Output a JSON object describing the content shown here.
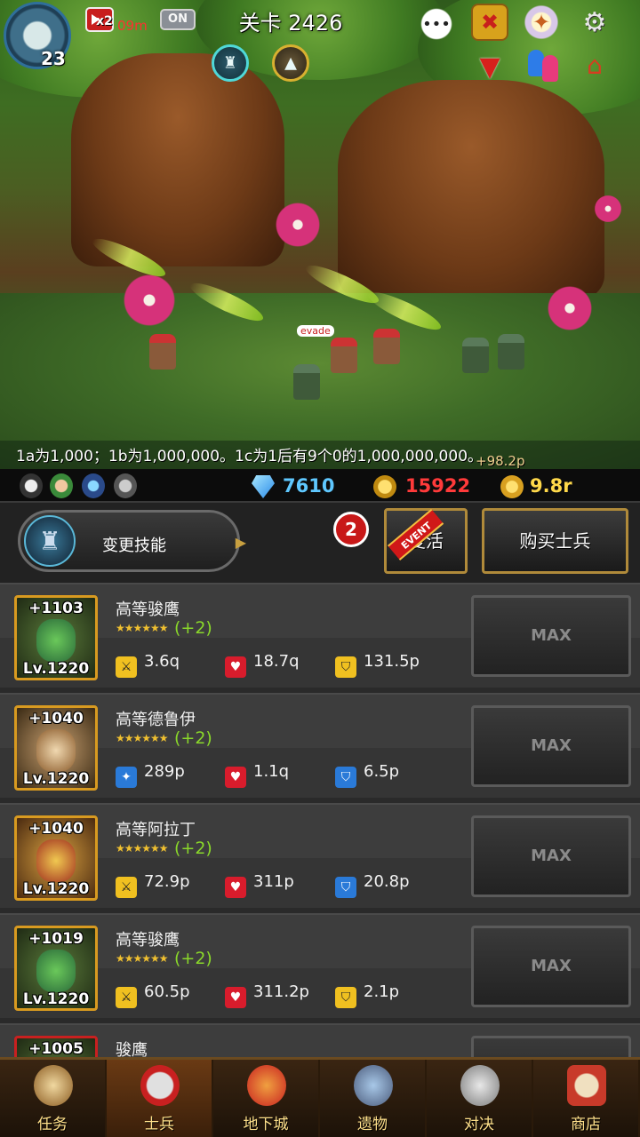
{
  "hud": {
    "hero_level": "23",
    "speed_label": "x2",
    "timer_label": "09m",
    "auto_toggle": "ON",
    "stage_title": "关卡 2426"
  },
  "scene": {
    "evade_tag": "evade",
    "notice": "1a为1,000；1b为1,000,000。1c为1后有9个0的1,000,000,000。",
    "gold_gain": "+98.2p"
  },
  "resources": {
    "gems": "7610",
    "medals": "15922",
    "gold": "9.8r"
  },
  "controls": {
    "change_skill": "变更技能",
    "notify_count": "2",
    "event_ribbon": "EVENT",
    "revive": "复活",
    "buy_soldier": "购买士兵"
  },
  "soldiers": [
    {
      "bonus": "+1103",
      "level": "Lv.1220",
      "name": "高等骏鹰",
      "stars": "★★★★★★",
      "upgrade": "(+2)",
      "stat1": "3.6q",
      "stat2": "18.7q",
      "stat3": "131.5p",
      "button": "MAX"
    },
    {
      "bonus": "+1040",
      "level": "Lv.1220",
      "name": "高等德鲁伊",
      "stars": "★★★★★★",
      "upgrade": "(+2)",
      "stat1": "289p",
      "stat2": "1.1q",
      "stat3": "6.5p",
      "button": "MAX"
    },
    {
      "bonus": "+1040",
      "level": "Lv.1220",
      "name": "高等阿拉丁",
      "stars": "★★★★★★",
      "upgrade": "(+2)",
      "stat1": "72.9p",
      "stat2": "311p",
      "stat3": "20.8p",
      "button": "MAX"
    },
    {
      "bonus": "+1019",
      "level": "Lv.1220",
      "name": "高等骏鹰",
      "stars": "★★★★★★",
      "upgrade": "(+2)",
      "stat1": "60.5p",
      "stat2": "311.2p",
      "stat3": "2.1p",
      "button": "MAX"
    },
    {
      "bonus": "+1005",
      "name": "骏鹰"
    }
  ],
  "nav": [
    {
      "label": "任务",
      "icon": "scroll-icon"
    },
    {
      "label": "士兵",
      "icon": "helmet-icon"
    },
    {
      "label": "地下城",
      "icon": "monster-icon"
    },
    {
      "label": "遗物",
      "icon": "orb-icon"
    },
    {
      "label": "对决",
      "icon": "crossed-swords-icon"
    },
    {
      "label": "商店",
      "icon": "shop-icon"
    }
  ],
  "colors": {
    "gem": "#5fc8ff",
    "medal": "#ff3a3a",
    "gold": "#ffd94a",
    "upgrade_green": "#8ad82a",
    "frame_gold": "#d89a20"
  }
}
